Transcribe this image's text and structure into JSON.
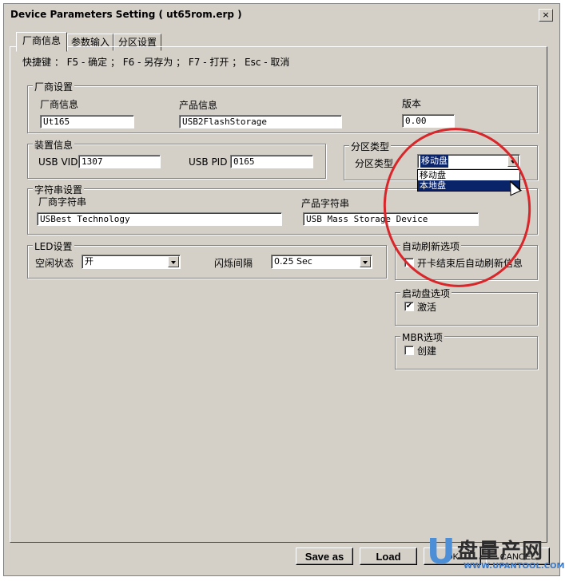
{
  "window": {
    "title": "Device Parameters Setting ( ut65rom.erp )",
    "close_glyph": "×"
  },
  "tabs": [
    {
      "label": "厂商信息"
    },
    {
      "label": "参数输入"
    },
    {
      "label": "分区设置"
    }
  ],
  "hotkeys": "快捷键 ： F5 - 确定 ； F6 - 另存为 ； F7 - 打开 ； Esc - 取消",
  "vendor_group": {
    "title": "厂商设置",
    "vendor_label": "厂商信息",
    "vendor_value": "Ut165",
    "product_label": "产品信息",
    "product_value": "USB2FlashStorage",
    "version_label": "版本",
    "version_value": "0.00"
  },
  "device_group": {
    "title": "装置信息",
    "vid_label": "USB VID",
    "vid_value": "1307",
    "pid_label": "USB PID",
    "pid_value": "0165"
  },
  "partition_group": {
    "title": "分区类型",
    "type_label": "分区类型",
    "selected": "移动盘",
    "options": [
      "移动盘",
      "本地盘"
    ]
  },
  "string_group": {
    "title": "字符串设置",
    "vendor_label": "厂商字符串",
    "vendor_value": "USBest Technology",
    "product_label": "产品字符串",
    "product_value": "USB Mass Storage Device"
  },
  "led_group": {
    "title": "LED设置",
    "idle_label": "空闲状态",
    "idle_value": "开",
    "blink_label": "闪烁间隔",
    "blink_value": "0.25 Sec"
  },
  "auto_refresh_group": {
    "title": "自动刷新选项",
    "option_label": "开卡结束后自动刷新信息",
    "checked": false
  },
  "boot_group": {
    "title": "启动盘选项",
    "option_label": "激活",
    "checked": true
  },
  "mbr_group": {
    "title": "MBR选项",
    "option_label": "创建",
    "checked": false
  },
  "buttons": {
    "save_as": "Save as",
    "load": "Load",
    "ok": "OK",
    "cancel": "CANCEL"
  },
  "watermark": {
    "brand": "盘量产网",
    "url": "WWW.UPANTOOL.COM",
    "letter": "U"
  },
  "colors": {
    "highlight": "#0a246a",
    "annotation_circle": "#d8262a",
    "face": "#d4d0c8"
  }
}
